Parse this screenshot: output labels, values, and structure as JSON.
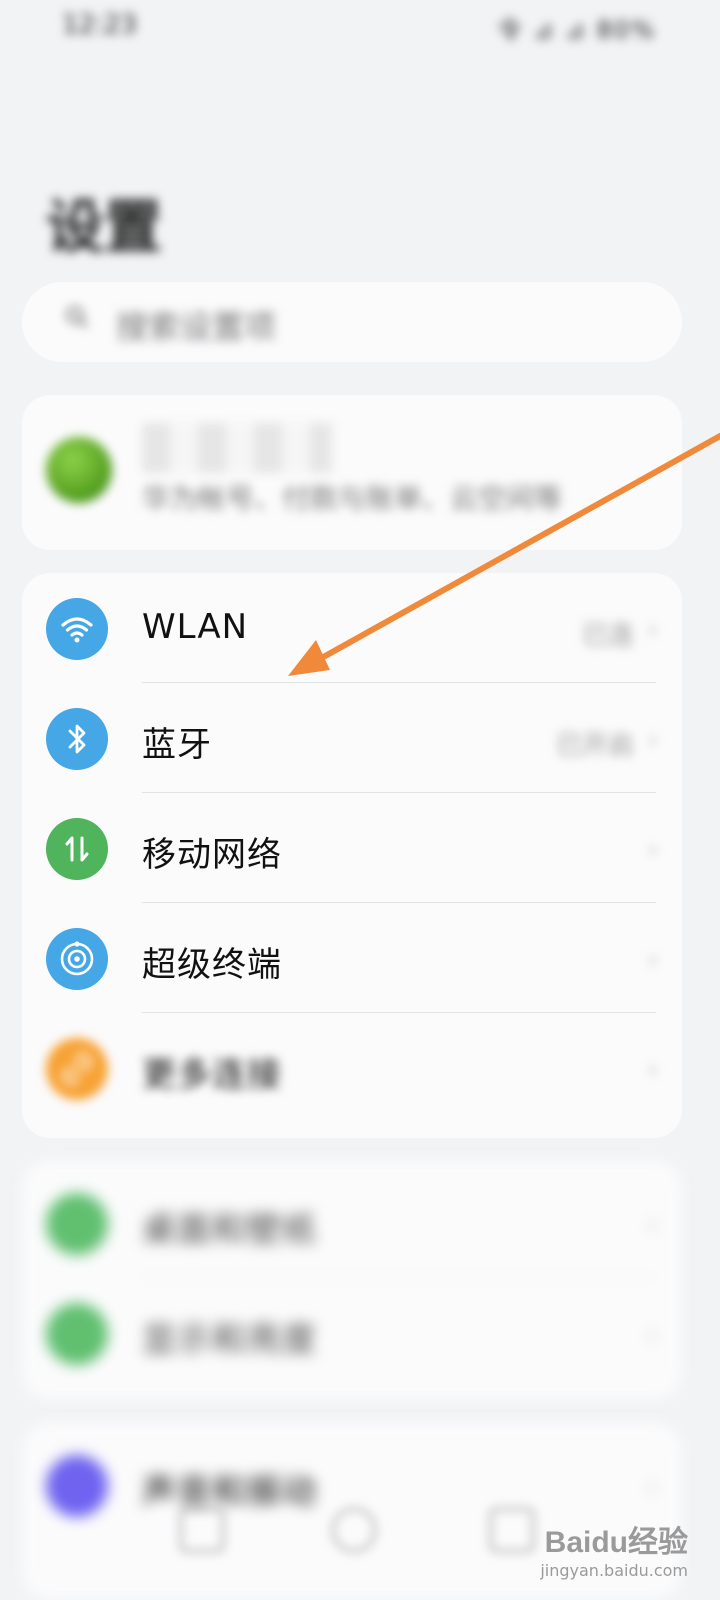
{
  "status_bar": {
    "time": "12:23",
    "icons": "令 ⊿ ⊿ 80%"
  },
  "page_title": "设置",
  "search": {
    "placeholder": "搜索设置项"
  },
  "account": {
    "name": "",
    "description": "华为帐号、付款与账单、云空间等"
  },
  "connections": {
    "items": [
      {
        "label": "WLAN",
        "value": "已连",
        "icon": "wifi-icon"
      },
      {
        "label": "蓝牙",
        "value": "已开启",
        "icon": "bluetooth-icon"
      },
      {
        "label": "移动网络",
        "value": "",
        "icon": "mobile-data-icon"
      },
      {
        "label": "超级终端",
        "value": "",
        "icon": "super-device-icon"
      },
      {
        "label": "更多连接",
        "value": "",
        "icon": "link-icon"
      }
    ]
  },
  "display": {
    "items": [
      {
        "label": "桌面和壁纸",
        "icon": "wallpaper-icon"
      },
      {
        "label": "显示和亮度",
        "icon": "brightness-icon"
      }
    ]
  },
  "more": {
    "items": [
      {
        "label": "声音和振动",
        "icon": "sound-icon"
      }
    ]
  },
  "chevron": "›",
  "watermark": {
    "logo": "Baidu经验",
    "url": "jingyan.baidu.com"
  },
  "colors": {
    "background": "#f1f3f5",
    "card": "#fbfbfc",
    "icon_blue": "#45a7e6",
    "icon_green": "#4fb45c",
    "icon_orange": "#f7a234",
    "icon_purple": "#6f63f0",
    "arrow": "#f0893a"
  }
}
